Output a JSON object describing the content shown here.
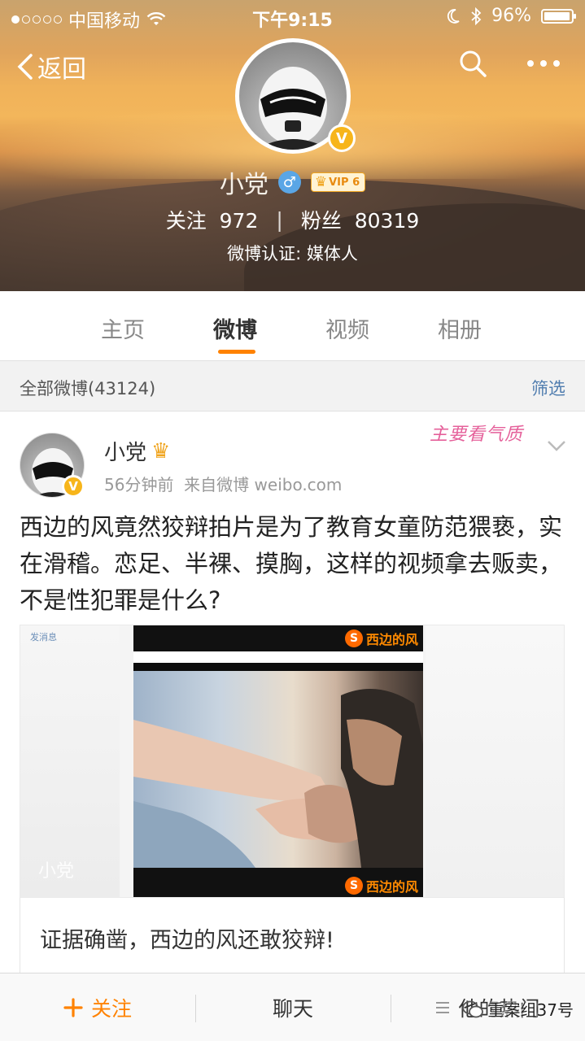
{
  "status_bar": {
    "carrier": "中国移动",
    "time": "下午9:15",
    "battery": "96%",
    "battery_level": 0.96,
    "signal_dots": [
      true,
      false,
      false,
      false,
      false
    ]
  },
  "header": {
    "back_label": "返回",
    "profile_name": "小党",
    "vip_label": "VIP 6",
    "follow_label": "关注",
    "follow_count": "972",
    "fans_label": "粉丝",
    "fans_count": "80319",
    "separator": "|",
    "certification": "微博认证: 媒体人"
  },
  "tabs": [
    {
      "label": "主页",
      "active": false
    },
    {
      "label": "微博",
      "active": true
    },
    {
      "label": "视频",
      "active": false
    },
    {
      "label": "相册",
      "active": false
    }
  ],
  "filter": {
    "all_posts": "全部微博(43124)",
    "filter_label": "筛选"
  },
  "post": {
    "author": "小党",
    "time": "56分钟前",
    "source": "来自微博 weibo.com",
    "decor_text": "主要看气质",
    "text": "西边的风竟然狡辩拍片是为了教育女童防范猥亵，实在滑稽。恋足、半裸、摸胸，这样的视频拿去贩卖，不是性犯罪是什么?",
    "media_side_text": "发消息",
    "media_logo": "西边的风",
    "media_watermark": "小党",
    "caption": "证据确凿，西边的风还敢狡辩!"
  },
  "bottom_bar": {
    "follow": "关注",
    "chat": "聊天",
    "hot": "他的热门"
  },
  "watermark": "重案组37号",
  "colors": {
    "accent": "#ff8200",
    "link": "#507daf",
    "verify": "#f7b51a",
    "gender": "#5aa6e6"
  }
}
